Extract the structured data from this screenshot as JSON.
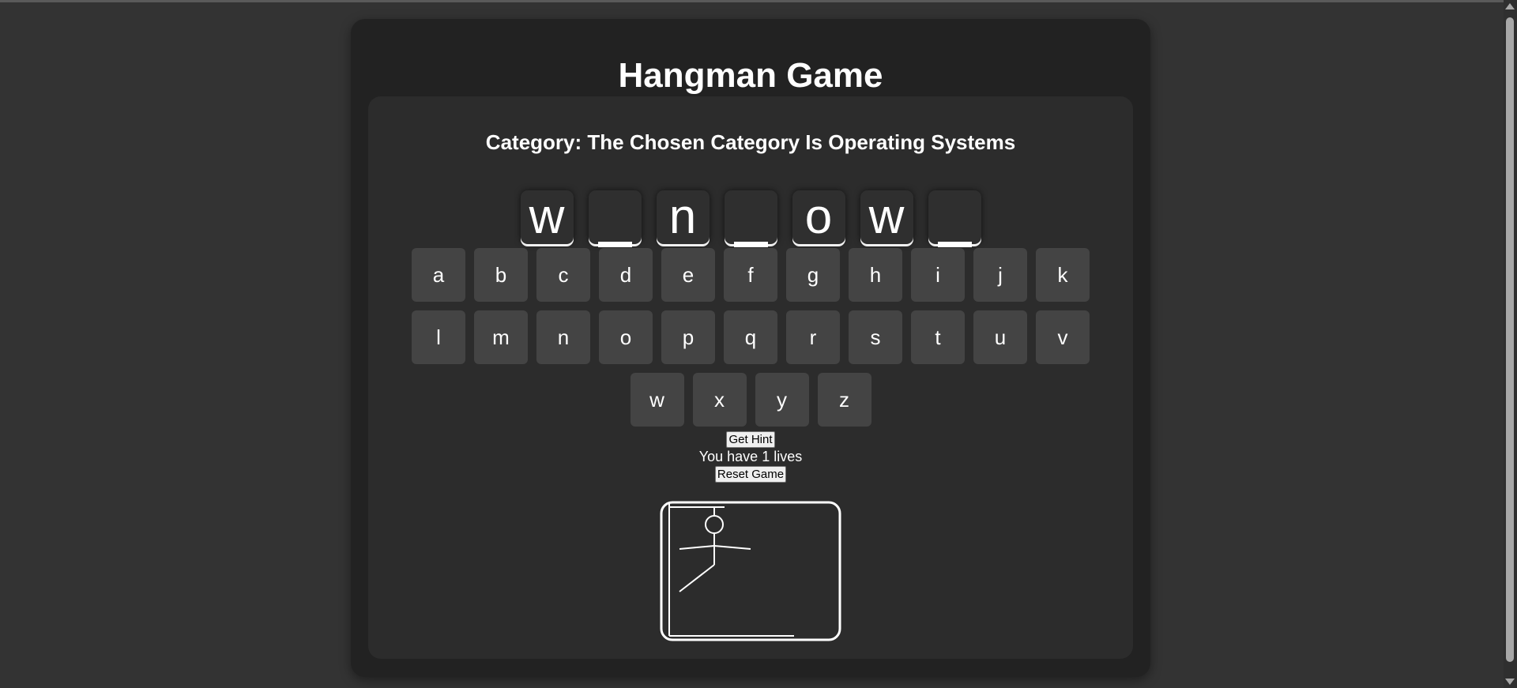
{
  "title": "Hangman Game",
  "category": "Category: The Chosen Category Is Operating Systems",
  "word": [
    {
      "letter": "w"
    },
    {
      "letter": "",
      "blank": true
    },
    {
      "letter": "n"
    },
    {
      "letter": "",
      "blank": true
    },
    {
      "letter": "o"
    },
    {
      "letter": "w"
    },
    {
      "letter": "",
      "blank": true
    }
  ],
  "keyboard": {
    "rows": [
      [
        "a",
        "b",
        "c",
        "d",
        "e",
        "f",
        "g",
        "h",
        "i",
        "j",
        "k"
      ],
      [
        "l",
        "m",
        "n",
        "o",
        "p",
        "q",
        "r",
        "s",
        "t",
        "u",
        "v"
      ],
      [
        "w",
        "x",
        "y",
        "z"
      ]
    ]
  },
  "hint_button": "Get Hint",
  "lives_text": "You have 1 lives",
  "reset_button": "Reset Game",
  "colors": {
    "page_bg": "#333333",
    "outer_card": "#222222",
    "inner_card": "#2c2c2c",
    "key_bg": "#444444",
    "drawing": "#ffffff"
  }
}
